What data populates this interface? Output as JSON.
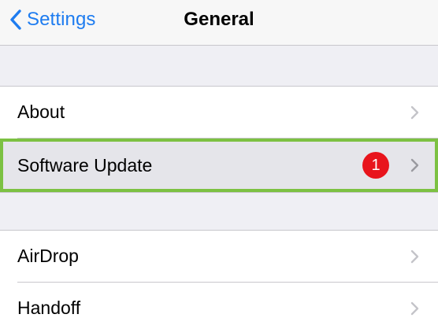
{
  "navbar": {
    "back_label": "Settings",
    "title": "General",
    "back_icon": "chevron-left-icon"
  },
  "groups": [
    {
      "rows": [
        {
          "label": "About",
          "icon": "chevron-right-icon"
        },
        {
          "label": "Software Update",
          "badge": "1",
          "icon": "chevron-right-icon",
          "highlighted": true
        }
      ]
    },
    {
      "rows": [
        {
          "label": "AirDrop",
          "icon": "chevron-right-icon"
        },
        {
          "label": "Handoff",
          "icon": "chevron-right-icon"
        }
      ]
    }
  ],
  "colors": {
    "accent": "#1e7cf0",
    "badge": "#e8141c",
    "highlight_border": "#7cc142",
    "background": "#efeff4"
  }
}
